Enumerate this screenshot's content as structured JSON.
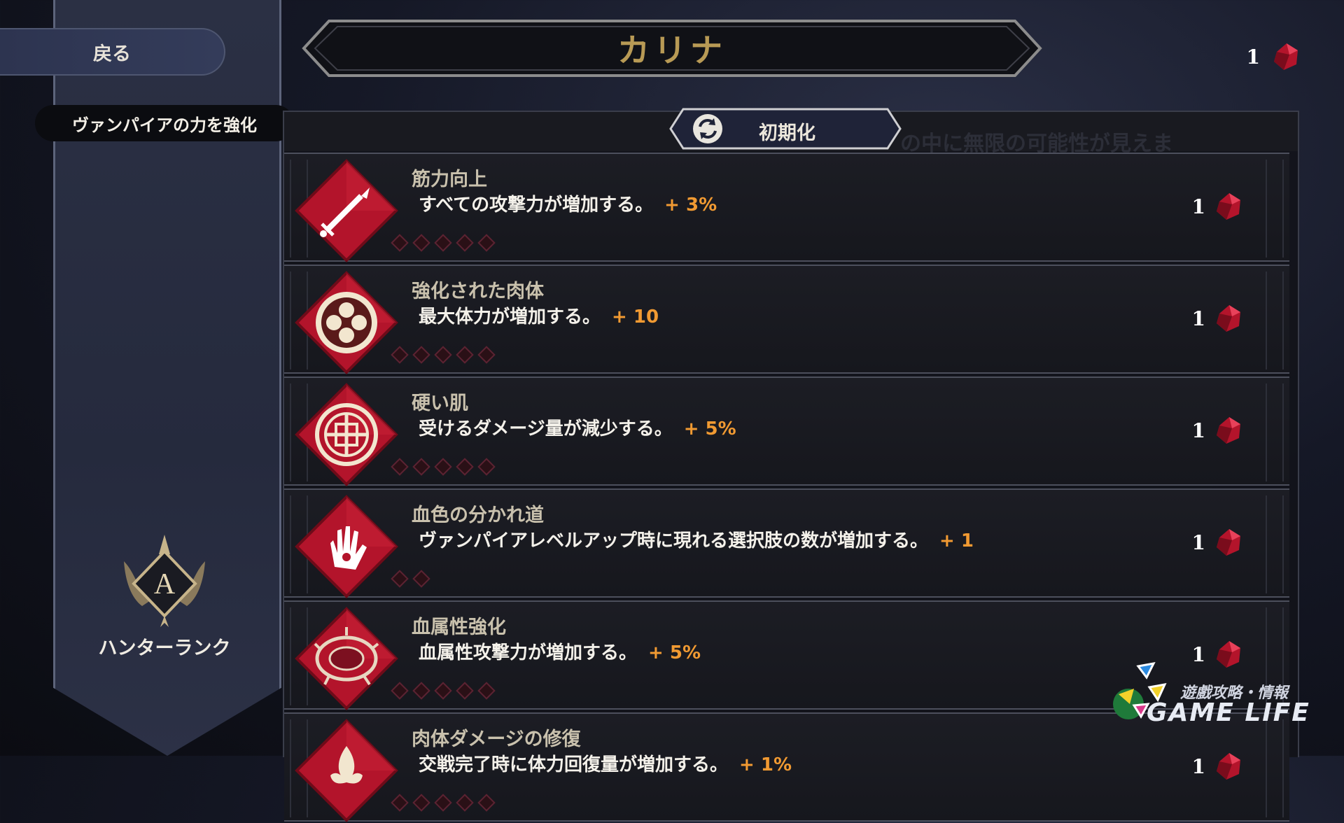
{
  "nav": {
    "back_label": "戻る",
    "category_label": "ヴァンパイアの力を強化"
  },
  "header": {
    "character_name": "カリナ",
    "currency_count": "1",
    "currency_icon": "blood-crystal-icon"
  },
  "toolbar": {
    "reset_label": "初期化",
    "background_text": "の中に無限の可能性が見えま"
  },
  "skills": [
    {
      "name": "筋力向上",
      "description": "すべての攻撃力が増加する。",
      "bonus": "+ 3%",
      "cost": "1",
      "icon": "sword-icon",
      "pips": 5
    },
    {
      "name": "強化された肉体",
      "description": "最大体力が増加する。",
      "bonus": "+ 10",
      "cost": "1",
      "icon": "clover-emblem-icon",
      "pips": 5
    },
    {
      "name": "硬い肌",
      "description": "受けるダメージ量が減少する。",
      "bonus": "+ 5%",
      "cost": "1",
      "icon": "shield-knot-icon",
      "pips": 5
    },
    {
      "name": "血色の分かれ道",
      "description": "ヴァンパイアレベルアップ時に現れる選択肢の数が増加する。",
      "bonus": "+ 1",
      "cost": "1",
      "icon": "bloody-hand-icon",
      "pips": 2
    },
    {
      "name": "血属性強化",
      "description": "血属性攻撃力が増加する。",
      "bonus": "+ 5%",
      "cost": "1",
      "icon": "thorn-crown-icon",
      "pips": 5
    },
    {
      "name": "肉体ダメージの修復",
      "description": "交戦完了時に体力回復量が増加する。",
      "bonus": "+ 1%",
      "cost": "1",
      "icon": "fleur-icon",
      "pips": 5
    }
  ],
  "rank": {
    "letter": "A",
    "label": "ハンターランク"
  },
  "watermark": {
    "line1": "遊戲攻略・情報",
    "line2": "GAME LIFE"
  },
  "colors": {
    "accent_orange": "#f19a32",
    "crimson": "#b3142b",
    "title_gold": "#b89a55"
  }
}
